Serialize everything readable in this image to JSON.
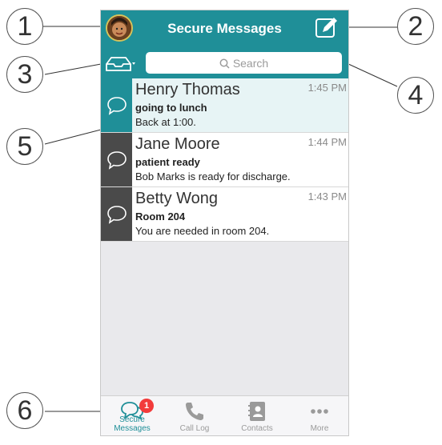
{
  "header": {
    "title": "Secure Messages"
  },
  "search": {
    "placeholder": "Search"
  },
  "messages": [
    {
      "name": "Henry Thomas",
      "time": "1:45 PM",
      "subject": "going to lunch",
      "preview": "Back at 1:00."
    },
    {
      "name": "Jane Moore",
      "time": "1:44 PM",
      "subject": "patient ready",
      "preview": "Bob Marks is ready for discharge."
    },
    {
      "name": "Betty Wong",
      "time": "1:43 PM",
      "subject": "Room 204",
      "preview": "You are needed in room 204."
    }
  ],
  "tabs": [
    {
      "label": "Secure Messages",
      "icon": "chat-bubbles-icon",
      "badge": "1"
    },
    {
      "label": "Call Log",
      "icon": "phone-icon"
    },
    {
      "label": "Contacts",
      "icon": "contacts-book-icon"
    },
    {
      "label": "More",
      "icon": "more-dots-icon"
    }
  ],
  "callouts": [
    "1",
    "2",
    "3",
    "4",
    "5",
    "6"
  ],
  "colors": {
    "accent": "#1f8f98",
    "unread_side": "#4a4a4a",
    "badge": "#f23b3b"
  }
}
